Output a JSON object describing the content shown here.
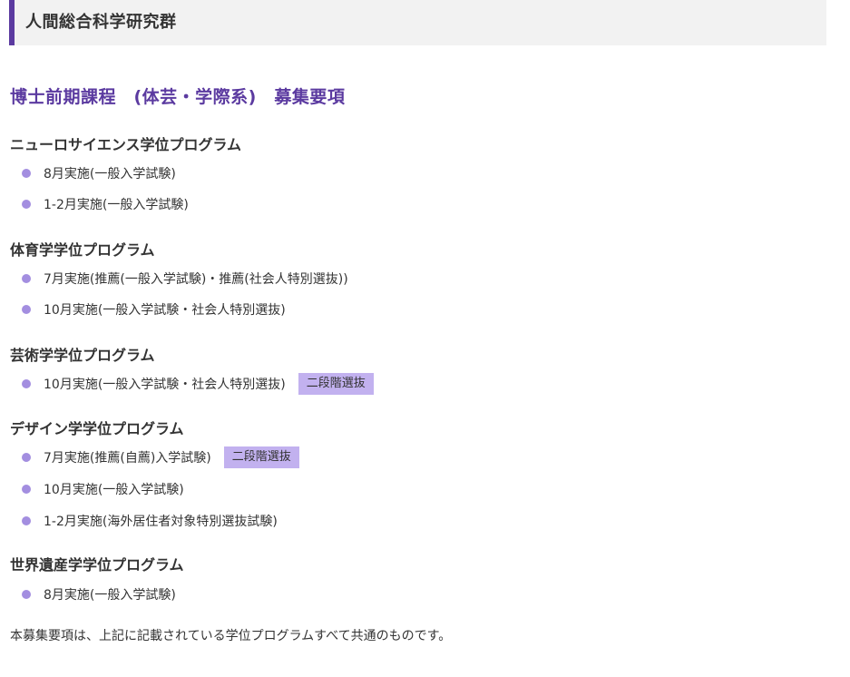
{
  "header": {
    "title": "人間総合科学研究群"
  },
  "page_title": "博士前期課程　(体芸・学際系)　募集要項",
  "programs": [
    {
      "title": "ニューロサイエンス学位プログラム",
      "items": [
        {
          "label": "8月実施(一般入学試験)"
        },
        {
          "label": "1-2月実施(一般入学試験)"
        }
      ]
    },
    {
      "title": "体育学学位プログラム",
      "items": [
        {
          "label": "7月実施(推薦(一般入学試験)・推薦(社会人特別選抜))"
        },
        {
          "label": "10月実施(一般入学試験・社会人特別選抜)"
        }
      ]
    },
    {
      "title": "芸術学学位プログラム",
      "items": [
        {
          "label": "10月実施(一般入学試験・社会人特別選抜)",
          "badge": "二段階選抜"
        }
      ]
    },
    {
      "title": "デザイン学学位プログラム",
      "items": [
        {
          "label": "7月実施(推薦(自薦)入学試験)",
          "badge": "二段階選抜"
        },
        {
          "label": "10月実施(一般入学試験)"
        },
        {
          "label": "1-2月実施(海外居住者対象特別選抜試験)"
        }
      ]
    },
    {
      "title": "世界遺産学学位プログラム",
      "items": [
        {
          "label": "8月実施(一般入学試験)"
        }
      ]
    }
  ],
  "footer_note": "本募集要項は、上記に記載されている学位プログラムすべて共通のものです。",
  "colors": {
    "accent": "#5b3aa0",
    "bullet": "#a38ee0",
    "badge_bg": "#c2b1ef",
    "header_bg": "#f2f2f2"
  }
}
